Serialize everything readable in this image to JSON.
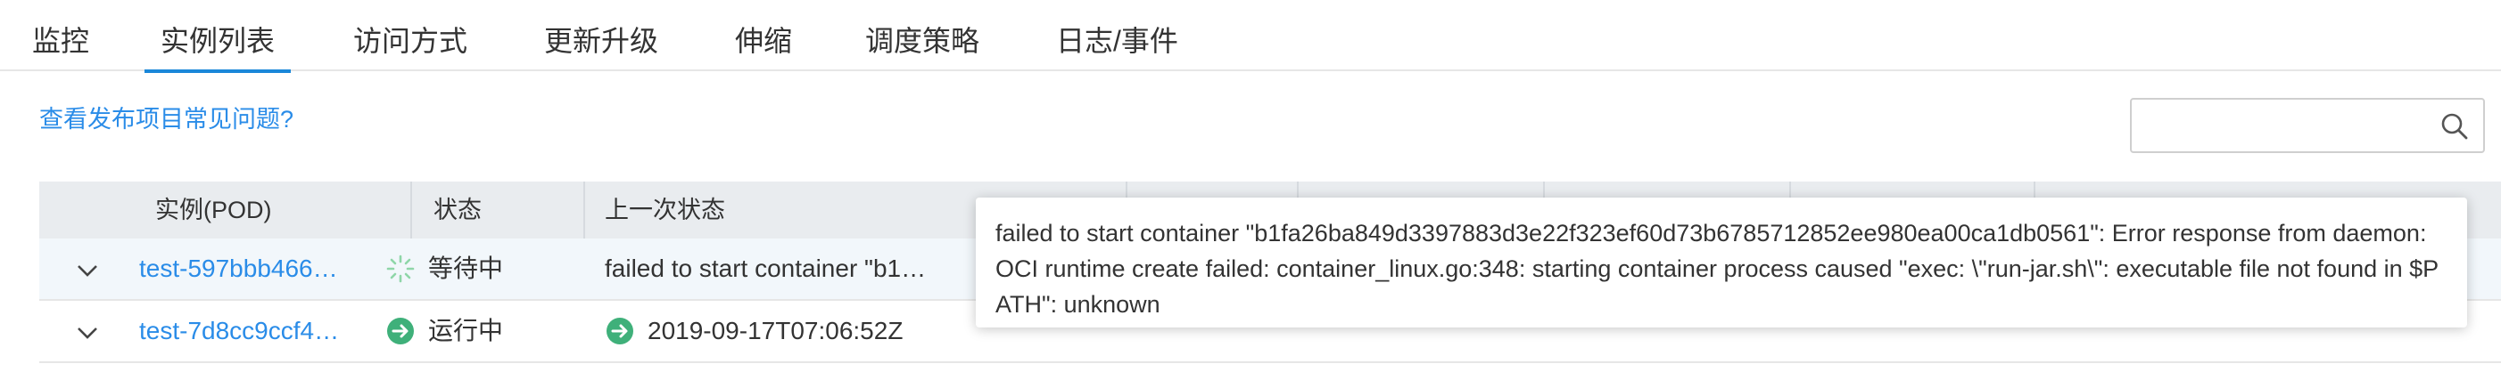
{
  "tabs": [
    {
      "label": "监控",
      "active": false
    },
    {
      "label": "实例列表",
      "active": true
    },
    {
      "label": "访问方式",
      "active": false
    },
    {
      "label": "更新升级",
      "active": false
    },
    {
      "label": "伸缩",
      "active": false
    },
    {
      "label": "调度策略",
      "active": false
    },
    {
      "label": "日志/事件",
      "active": false
    }
  ],
  "help_link": "查看发布项目常见问题?",
  "search": {
    "placeholder": "",
    "value": "",
    "icon": "search-icon"
  },
  "table": {
    "headers": {
      "pod": "实例(POD)",
      "status": "状态",
      "last_status": "上一次状态"
    },
    "rows": [
      {
        "pod": "test-597bbb466…",
        "status": "等待中",
        "status_icon": "spinner-icon",
        "last_status": "failed to start container \"b1…",
        "last_status_icon": ""
      },
      {
        "pod": "test-7d8cc9ccf4…",
        "status": "运行中",
        "status_icon": "running-arrow-icon",
        "last_status": "2019-09-17T07:06:52Z",
        "last_status_icon": "running-arrow-icon"
      }
    ]
  },
  "tooltip": {
    "text": "failed to start container \"b1fa26ba849d3397883d3e22f323ef60d73b6785712852ee980ea00ca1db0561\": Error response from daemon: OCI runtime create failed: container_linux.go:348: starting container process caused \"exec: \\\"run-jar.sh\\\": executable file not found in $PATH\": unknown"
  },
  "colors": {
    "accent": "#1a87d9",
    "link": "#2a8ce8",
    "running_green": "#3fb07a",
    "header_bg": "#e9ecef",
    "selected_row_bg": "#f2f7fb"
  }
}
